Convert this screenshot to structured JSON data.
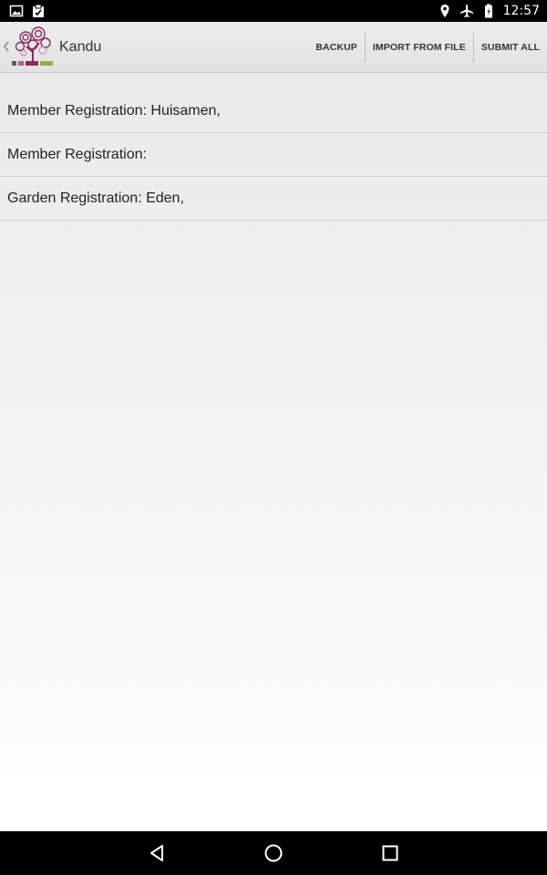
{
  "status_bar": {
    "time": "12:57",
    "left_icons": [
      "image-icon",
      "clipboard-icon"
    ],
    "right_icons": [
      "location-icon",
      "airplane-icon",
      "battery-icon"
    ]
  },
  "action_bar": {
    "title": "Kandu",
    "actions": [
      {
        "label": "BACKUP"
      },
      {
        "label": "IMPORT FROM FILE"
      },
      {
        "label": "SUBMIT ALL"
      }
    ]
  },
  "list": {
    "items": [
      {
        "label": "Member Registration: Huisamen,"
      },
      {
        "label": "Member Registration:"
      },
      {
        "label": "Garden Registration: Eden,"
      }
    ]
  },
  "nav_bar": {
    "buttons": [
      "back-icon",
      "home-icon",
      "recents-icon"
    ]
  },
  "colors": {
    "action_bar_bg": "#e6e6e6",
    "logo_purple": "#8b2a5a",
    "logo_green": "#8cb43c"
  }
}
